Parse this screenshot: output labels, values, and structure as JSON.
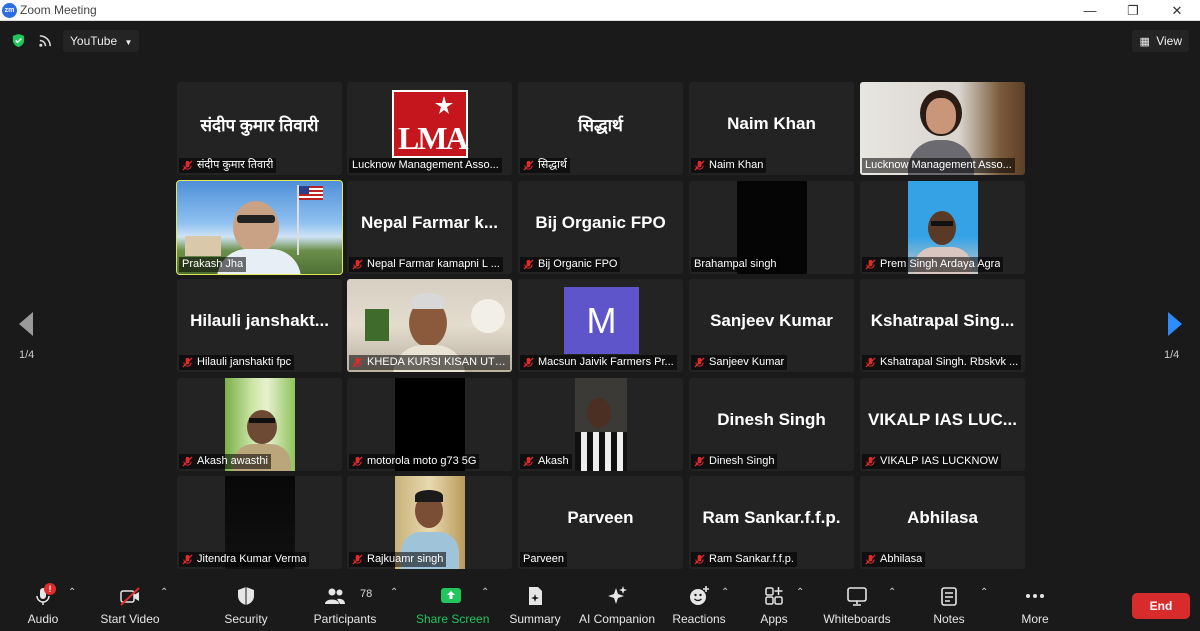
{
  "window": {
    "title": "Zoom Meeting",
    "app_logo_text": "zm"
  },
  "topbar": {
    "youtube_label": "YouTube",
    "view_label": "View"
  },
  "gallery": {
    "page_indicator_left": "1/4",
    "page_indicator_right": "1/4",
    "tiles": [
      {
        "big": "संदीप कुमार तिवारी",
        "label": "संदीप कुमार तिवारी",
        "muted": true
      },
      {
        "big": "",
        "label": "Lucknow Management Asso...",
        "muted": false,
        "logo_text": "LMA"
      },
      {
        "big": "सिद्धार्थ",
        "label": "सिद्धार्थ",
        "muted": true
      },
      {
        "big": "Naim Khan",
        "label": "Naim Khan",
        "muted": true
      },
      {
        "big": "",
        "label": "Lucknow Management Asso...",
        "muted": false
      },
      {
        "big": "",
        "label": "Prakash Jha",
        "muted": false
      },
      {
        "big": "Nepal Farmar k...",
        "label": "Nepal Farmar kamapni L ...",
        "muted": true
      },
      {
        "big": "Bij Organic FPO",
        "label": "Bij Organic FPO",
        "muted": true
      },
      {
        "big": "",
        "label": "Brahampal singh",
        "muted": false
      },
      {
        "big": "",
        "label": "Prem Singh Ardaya Agra",
        "muted": true
      },
      {
        "big": "Hilauli janshakt...",
        "label": "Hilauli janshakti fpc",
        "muted": true
      },
      {
        "big": "",
        "label": "KHEDA KURSI KISAN UTP...",
        "muted": true
      },
      {
        "big": "",
        "label": "Macsun Jaivik Farmers Pr...",
        "muted": true,
        "avatar_letter": "M"
      },
      {
        "big": "Sanjeev Kumar",
        "label": "Sanjeev Kumar",
        "muted": true
      },
      {
        "big": "Kshatrapal Sing...",
        "label": "Kshatrapal Singh. Rbskvk ...",
        "muted": true
      },
      {
        "big": "",
        "label": "Akash awasthi",
        "muted": true
      },
      {
        "big": "",
        "label": "motorola moto g73 5G",
        "muted": true
      },
      {
        "big": "",
        "label": "Akash",
        "muted": true
      },
      {
        "big": "Dinesh Singh",
        "label": "Dinesh Singh",
        "muted": true
      },
      {
        "big": "VIKALP IAS LUC...",
        "label": "VIKALP IAS LUCKNOW",
        "muted": true
      },
      {
        "big": "",
        "label": "Jitendra Kumar Verma",
        "muted": true
      },
      {
        "big": "",
        "label": "Rajkuamr singh",
        "muted": true
      },
      {
        "big": "Parveen",
        "label": "Parveen",
        "muted": false
      },
      {
        "big": "Ram Sankar.f.f.p.",
        "label": "Ram Sankar.f.f.p.",
        "muted": true
      },
      {
        "big": "Abhilasa",
        "label": "Abhilasa",
        "muted": true
      }
    ]
  },
  "toolbar": {
    "audio": "Audio",
    "audio_badge": "!",
    "start_video": "Start Video",
    "security": "Security",
    "participants": "Participants",
    "participants_count": "78",
    "share_screen": "Share Screen",
    "summary": "Summary",
    "ai_companion": "AI Companion",
    "reactions": "Reactions",
    "apps": "Apps",
    "whiteboards": "Whiteboards",
    "notes": "Notes",
    "more": "More",
    "end": "End"
  },
  "colors": {
    "accent_green": "#22c55e",
    "end_red": "#d82c2c",
    "speaker_outline": "#e3e85a",
    "nav_arrow": "#2d8cff"
  }
}
